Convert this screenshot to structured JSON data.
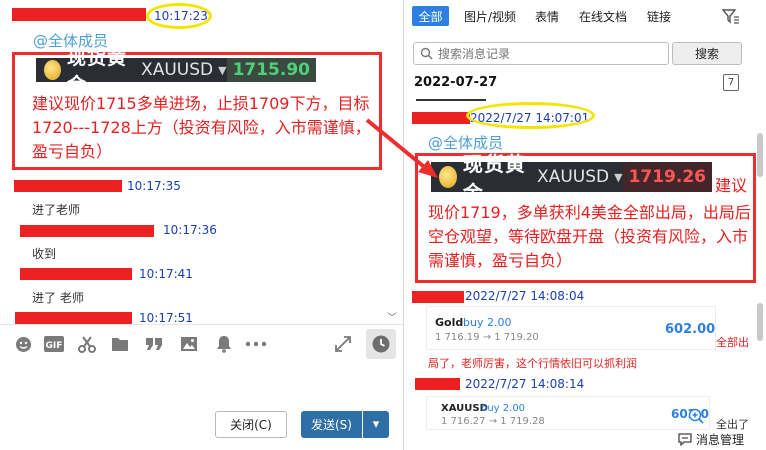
{
  "left": {
    "top_time": "10:17:23",
    "mention": "@全体成员",
    "ticker": {
      "name": "现货黄金",
      "symbol": "XAUUSD",
      "caret": "▼",
      "price": "1715.90"
    },
    "message": "建议现价1715多单进场，止损1709下方，目标1720---1728上方（投资有风险，入市需谨慎，盈亏自负）",
    "replies": [
      {
        "time": "10:17:35",
        "text": "进了老师"
      },
      {
        "time": "10:17:36",
        "text": "收到"
      },
      {
        "time": "10:17:41",
        "text": "进了  老师"
      },
      {
        "time": "10:17:51",
        "text": ""
      }
    ],
    "buttons": {
      "close": "关闭(C)",
      "send": "发送(S)",
      "send_dropdown": "▾"
    }
  },
  "right": {
    "tabs": [
      "全部",
      "图片/视频",
      "表情",
      "在线文档",
      "链接"
    ],
    "search": {
      "placeholder": "搜索消息记录",
      "button": "搜索"
    },
    "date": "2022-07-27",
    "calendar_day": "7",
    "post_time": "2022/7/27 14:07:01",
    "mention": "@全体成员",
    "ticker": {
      "name": "现货黄金",
      "symbol": "XAUUSD",
      "caret": "▼",
      "price": "1719.26"
    },
    "message_lead": "建议",
    "message": "现价1719，多单获利4美金全部出局，出局后空仓观望，等待欧盘开盘（投资有风险，入市需谨慎，盈亏自负）",
    "entries": [
      {
        "time": "2022/7/27 14:08:04",
        "label": "Gold",
        "side": "buy 2.00",
        "range": "1 716.19 → 1 719.20",
        "profit": "602.00",
        "note": "全部出",
        "comment": "局了，老师厉害，这个行情依旧可以抓利润"
      },
      {
        "time": "2022/7/27 14:08:14",
        "label": "XAUUSD",
        "side": "buy 2.00",
        "range": "1 716.27 → 1 719.28",
        "profit": "602.0",
        "note": "全出了"
      }
    ],
    "footer": "消息管理"
  },
  "colors": {
    "accent_blue": "#2d80e0",
    "annotation_red": "#ee2d2d",
    "highlight_yellow": "#f5e400",
    "ticker_bg": "#2a2d33",
    "price_green": "#3fb96a",
    "price_red": "#ff4d4d"
  }
}
